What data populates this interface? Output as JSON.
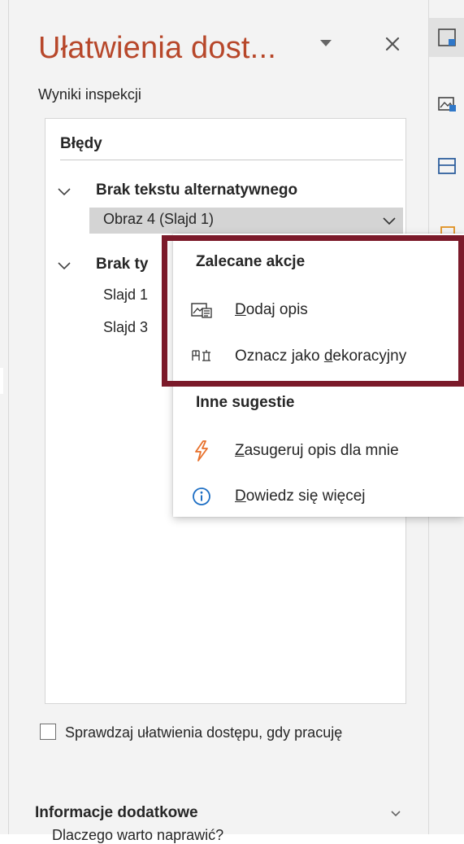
{
  "pane": {
    "title": "Ułatwienia dost...",
    "section_label": "Wyniki inspekcji"
  },
  "errors": {
    "heading": "Błędy",
    "groups": [
      {
        "title": "Brak tekstu alternatywnego",
        "items": [
          {
            "label": "Obraz 4  (Slajd 1)",
            "selected": true
          }
        ]
      },
      {
        "title": "Brak ty",
        "items": [
          {
            "label": "Slajd 1"
          },
          {
            "label": "Slajd 3"
          }
        ]
      }
    ]
  },
  "context_menu": {
    "recommended_heading": "Zalecane akcje",
    "recommended": [
      {
        "icon": "image-alt-text-icon",
        "label_prefix": "",
        "label_underlined": "D",
        "label_rest": "odaj opis"
      },
      {
        "icon": "decorative-icon",
        "label_prefix": "Oznacz jako ",
        "label_underlined": "d",
        "label_rest": "ekoracyjny"
      }
    ],
    "other_heading": "Inne sugestie",
    "other": [
      {
        "icon": "lightning-icon",
        "label_prefix": "",
        "label_underlined": "Z",
        "label_rest": "asugeruj opis dla mnie"
      },
      {
        "icon": "info-icon",
        "label_prefix": "",
        "label_underlined": "D",
        "label_rest": "owiedz się więcej"
      }
    ]
  },
  "footer": {
    "checkbox_label": "Sprawdzaj ułatwienia dostępu, gdy pracuję",
    "checkbox_checked": false,
    "info_heading": "Informacje dodatkowe",
    "info_link": "Dlaczego warto naprawić?"
  },
  "colors": {
    "title": "#b7472a",
    "highlight_border": "#7b1a2a",
    "lightning": "#e8712c",
    "info": "#1e6fc4"
  },
  "right_toolbar": {
    "buttons": [
      "design-icon",
      "alt-text-icon",
      "layout-icon",
      "shapes-icon"
    ]
  }
}
